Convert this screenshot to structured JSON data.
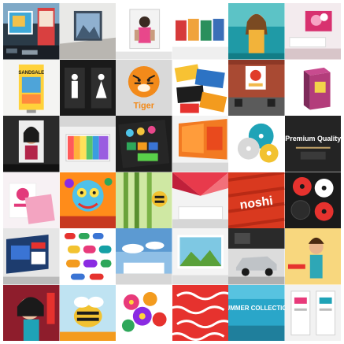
{
  "collage": {
    "rows": 6,
    "cols": 6,
    "tile_texts": {
      "r1c1": "SANDSALE",
      "r1c2": "Tiger",
      "r2c5": "Premium Quality",
      "r3c4": "noshi",
      "r5c4": "SUMMER COLLECTION"
    },
    "palette": {
      "red": "#e6322e",
      "orange": "#f39b1e",
      "yellow": "#ffd43a",
      "teal": "#15a0a5",
      "blue": "#1f6fb7",
      "pink": "#e83a7a",
      "dark": "#1c1c1c",
      "grey": "#d7d8da"
    }
  }
}
